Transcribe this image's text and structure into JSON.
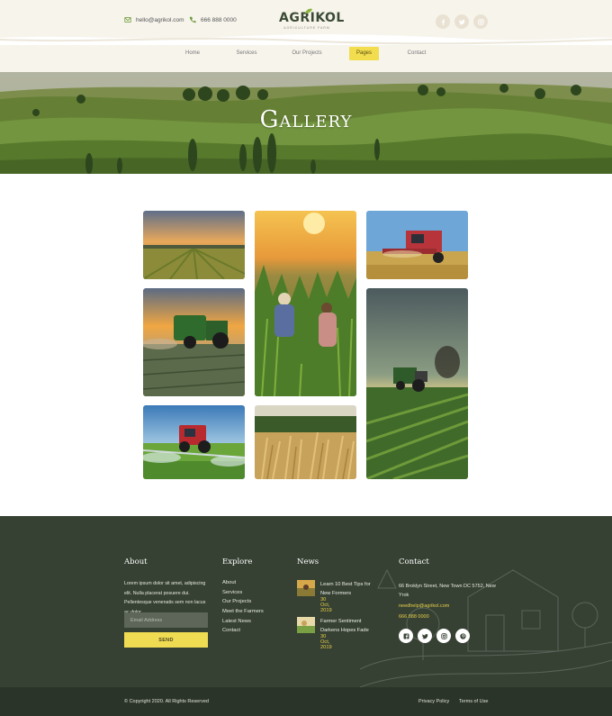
{
  "header": {
    "email": "hello@agrikol.com",
    "phone": "666 888 0000",
    "logo_word": "AGRIKOL",
    "logo_tagline": "AGRICULTURE FARM",
    "social_icons": [
      "facebook-icon",
      "twitter-icon",
      "instagram-icon"
    ]
  },
  "nav": {
    "items": [
      {
        "label": "Home"
      },
      {
        "label": "Services"
      },
      {
        "label": "Our Projects"
      },
      {
        "label": "Pages"
      },
      {
        "label": "Contact"
      }
    ],
    "active_index": 3
  },
  "hero": {
    "title": "Gallery"
  },
  "gallery": {
    "items": [
      {
        "subject": "sunset field rows"
      },
      {
        "subject": "farmers in corn field at sunset"
      },
      {
        "subject": "red combine harvester"
      },
      {
        "subject": "green tractor with baler at sunset"
      },
      {
        "subject": "tractor in green crop rows"
      },
      {
        "subject": "tractor spraying crops"
      },
      {
        "subject": "golden wheat field"
      }
    ]
  },
  "footer": {
    "about": {
      "heading": "About",
      "text": "Lorem ipsum dolor sit amet, adipiscing elit. Nulla placerat posuere dui. Pellentesque venenatis sem non lacus ac dolor.",
      "email_placeholder": "Email Address",
      "send_label": "SEND"
    },
    "explore": {
      "heading": "Explore",
      "links": [
        "About",
        "Services",
        "Our Projects",
        "Meet the Farmers",
        "Latest News",
        "Contact"
      ]
    },
    "news": {
      "heading": "News",
      "items": [
        {
          "title": "Learn 10 Best Tips for New Formers",
          "date": "30 Oct, 2019"
        },
        {
          "title": "Farmer Sentiment Darkens Hopes Fade",
          "date": "30 Oct, 2019"
        }
      ]
    },
    "contact": {
      "heading": "Contact",
      "address": "66 Broklyn Street, New Town DC 5752, New Yrok",
      "email": "needhelp@agrikol.com",
      "phone": "666 888 0000",
      "social_icons": [
        "facebook-icon",
        "twitter-icon",
        "instagram-icon",
        "pinterest-icon"
      ]
    },
    "copyright": "© Copyright 2020. All Rights Reserved",
    "bottom_links": [
      "Privacy Policy",
      "Terms of Use"
    ]
  },
  "colors": {
    "accent_yellow": "#f2dd4e",
    "footer_bg": "#364133",
    "footer_bottom": "#2b3428",
    "header_bg": "#f7f4ec"
  }
}
